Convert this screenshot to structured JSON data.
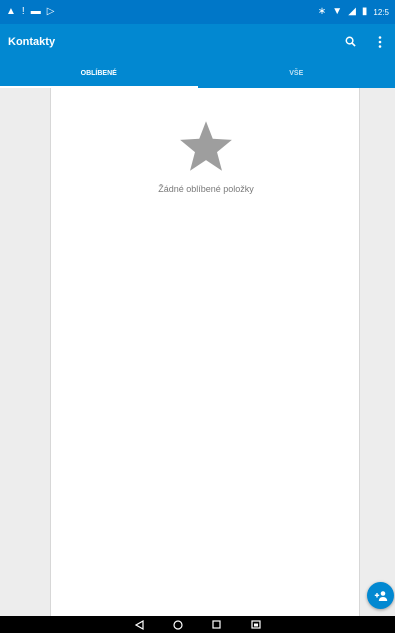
{
  "status_bar": {
    "left_icons": [
      "warning-icon",
      "alert-icon",
      "image-icon",
      "play-store-icon"
    ],
    "right_icons": [
      "bluetooth-icon",
      "wifi-icon",
      "signal-icon",
      "battery-icon"
    ],
    "time": "12:5"
  },
  "app_bar": {
    "title": "Kontakty",
    "actions": [
      "search-icon",
      "more-vert-icon"
    ]
  },
  "tabs": [
    {
      "label": "OBLÍBENÉ",
      "active": true
    },
    {
      "label": "VŠE",
      "active": false
    }
  ],
  "empty_state": {
    "icon": "star-icon",
    "message": "Žádné oblíbené položky"
  },
  "fab": {
    "icon": "add-contact-icon"
  },
  "nav_bar": [
    "back-icon",
    "home-icon",
    "recents-icon",
    "screenshot-icon"
  ],
  "colors": {
    "primary": "#0288d1",
    "status_bar": "#0077c8",
    "star": "#9e9e9e"
  }
}
